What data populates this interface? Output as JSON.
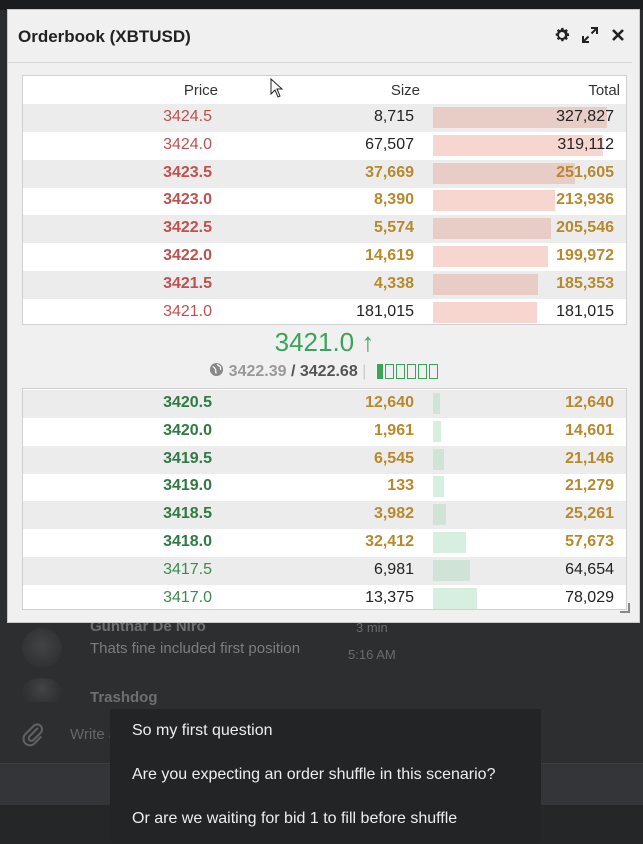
{
  "window": {
    "title": "Orderbook (XBTUSD)"
  },
  "headers": {
    "price": "Price",
    "size": "Size",
    "total": "Total"
  },
  "asks": [
    {
      "price": "3424.5",
      "size": "8,715",
      "total": "327,827",
      "bar": 0.94,
      "bold": false
    },
    {
      "price": "3424.0",
      "size": "67,507",
      "total": "319,112",
      "bar": 0.92,
      "bold": false
    },
    {
      "price": "3423.5",
      "size": "37,669",
      "total": "251,605",
      "bar": 0.77,
      "bold": true
    },
    {
      "price": "3423.0",
      "size": "8,390",
      "total": "213,936",
      "bar": 0.66,
      "bold": true
    },
    {
      "price": "3422.5",
      "size": "5,574",
      "total": "205,546",
      "bar": 0.64,
      "bold": true
    },
    {
      "price": "3422.0",
      "size": "14,619",
      "total": "199,972",
      "bar": 0.62,
      "bold": true
    },
    {
      "price": "3421.5",
      "size": "4,338",
      "total": "185,353",
      "bar": 0.57,
      "bold": true
    },
    {
      "price": "3421.0",
      "size": "181,015",
      "total": "181,015",
      "bar": 0.56,
      "bold": false
    }
  ],
  "mid": {
    "last_price": "3421.0",
    "arrow": "↑",
    "mark_price": "3422.39",
    "separator": "/",
    "index_price": "3422.68",
    "liquidity_level": 1,
    "liquidity_max": 6
  },
  "bids": [
    {
      "price": "3420.5",
      "size": "12,640",
      "total": "12,640",
      "bar": 0.04,
      "bold": true
    },
    {
      "price": "3420.0",
      "size": "1,961",
      "total": "14,601",
      "bar": 0.045,
      "bold": true
    },
    {
      "price": "3419.5",
      "size": "6,545",
      "total": "21,146",
      "bar": 0.06,
      "bold": true
    },
    {
      "price": "3419.0",
      "size": "133",
      "total": "21,279",
      "bar": 0.06,
      "bold": true
    },
    {
      "price": "3418.5",
      "size": "3,982",
      "total": "25,261",
      "bar": 0.07,
      "bold": true
    },
    {
      "price": "3418.0",
      "size": "32,412",
      "total": "57,673",
      "bar": 0.18,
      "bold": true
    },
    {
      "price": "3417.5",
      "size": "6,981",
      "total": "64,654",
      "bar": 0.2,
      "bold": false
    },
    {
      "price": "3417.0",
      "size": "13,375",
      "total": "78,029",
      "bar": 0.24,
      "bold": false
    }
  ],
  "chat": {
    "msg1": {
      "name": "Gunthar De Niro",
      "text": "Thats fine included first position",
      "time_ago": "3 min",
      "time": "5:16 AM"
    },
    "msg2": {
      "name": "Trashdog"
    },
    "input_placeholder": "Write a message..."
  },
  "popup": {
    "items": [
      "So my first question",
      "Are you expecting an order shuffle in this scenario?",
      "Or are we waiting for bid 1 to fill before shuffle"
    ]
  },
  "colors": {
    "ask_bar": "#f7d6d0",
    "ask_bar_alt": "#e8ccc6",
    "bid_bar": "#d7efe0",
    "bid_bar_alt": "#cfe3d6",
    "accent_green": "#3aa55a"
  }
}
